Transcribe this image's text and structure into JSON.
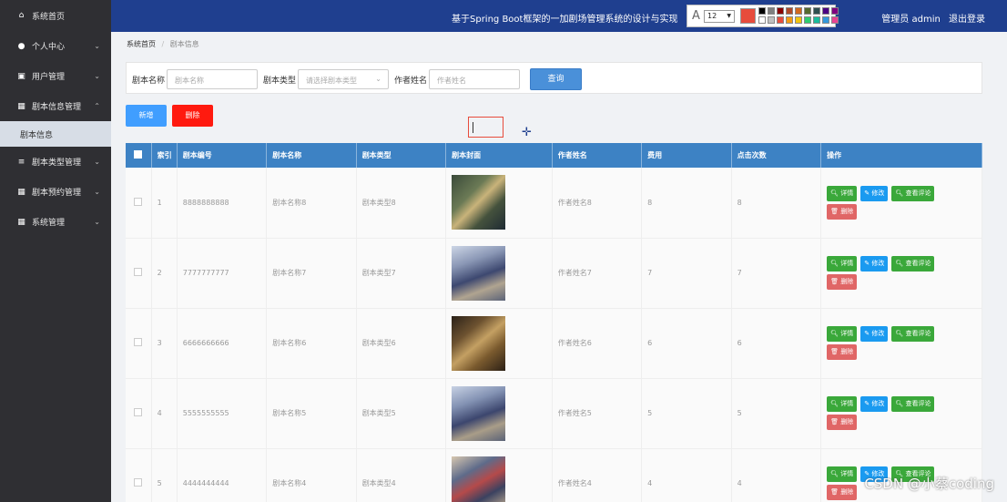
{
  "sidebar": {
    "items": [
      {
        "label": "系统首页",
        "icon": "home-icon",
        "glyph": "⌂"
      },
      {
        "label": "个人中心",
        "icon": "user-icon",
        "glyph": "●",
        "arrow": "⌄"
      },
      {
        "label": "用户管理",
        "icon": "clipboard-icon",
        "glyph": "▣",
        "arrow": "⌄"
      },
      {
        "label": "剧本信息管理",
        "icon": "grid-icon",
        "glyph": "▦",
        "arrow": "⌃"
      },
      {
        "label": "剧本信息",
        "sub": true
      },
      {
        "label": "剧本类型管理",
        "icon": "list-icon",
        "glyph": "≡",
        "arrow": "⌄"
      },
      {
        "label": "剧本预约管理",
        "icon": "grid-icon",
        "glyph": "▦",
        "arrow": "⌄"
      },
      {
        "label": "系统管理",
        "icon": "grid-icon",
        "glyph": "▦",
        "arrow": "⌄"
      }
    ]
  },
  "header": {
    "title": "基于Spring Boot框架的一加剧场管理系统的设计与实现",
    "user": "管理员 admin",
    "logout": "退出登录"
  },
  "toolbar": {
    "text_tool": "A",
    "font_size": "12",
    "current_color": "#e74c3c",
    "swatches": [
      "#000000",
      "#7f7f7f",
      "#8b0000",
      "#b04a2a",
      "#d2691e",
      "#556b2f",
      "#2f4f4f",
      "#4b0082",
      "#800080",
      "#ffffff",
      "#c0c0c0",
      "#e74c3c",
      "#f39c12",
      "#f1c40f",
      "#2ecc71",
      "#1abc9c",
      "#3498db",
      "#e84393"
    ]
  },
  "breadcrumb": {
    "home": "系统首页",
    "sep": "/",
    "current": "剧本信息"
  },
  "search": {
    "name_label": "剧本名称",
    "name_placeholder": "剧本名称",
    "type_label": "剧本类型",
    "type_placeholder": "请选择剧本类型",
    "author_label": "作者姓名",
    "author_placeholder": "作者姓名",
    "search_button": "查询"
  },
  "actions": {
    "add": "新增",
    "delete": "删除"
  },
  "table": {
    "headers": [
      "索引",
      "剧本编号",
      "剧本名称",
      "剧本类型",
      "剧本封面",
      "作者姓名",
      "费用",
      "点击次数",
      "操作"
    ],
    "buttons": {
      "detail": "详情",
      "edit": "修改",
      "review": "查看评论",
      "delete": "删除"
    },
    "rows": [
      {
        "index": "1",
        "code": "8888888888",
        "name": "剧本名称8",
        "type": "剧本类型8",
        "author": "作者姓名8",
        "fee": "8",
        "clicks": "8",
        "cover": "cover-a"
      },
      {
        "index": "2",
        "code": "7777777777",
        "name": "剧本名称7",
        "type": "剧本类型7",
        "author": "作者姓名7",
        "fee": "7",
        "clicks": "7",
        "cover": "cover-b"
      },
      {
        "index": "3",
        "code": "6666666666",
        "name": "剧本名称6",
        "type": "剧本类型6",
        "author": "作者姓名6",
        "fee": "6",
        "clicks": "6",
        "cover": "cover-c"
      },
      {
        "index": "4",
        "code": "5555555555",
        "name": "剧本名称5",
        "type": "剧本类型5",
        "author": "作者姓名5",
        "fee": "5",
        "clicks": "5",
        "cover": "cover-d"
      },
      {
        "index": "5",
        "code": "4444444444",
        "name": "剧本名称4",
        "type": "剧本类型4",
        "author": "作者姓名4",
        "fee": "4",
        "clicks": "4",
        "cover": "cover-e"
      }
    ]
  },
  "watermark": "CSDN @小蔡coding"
}
